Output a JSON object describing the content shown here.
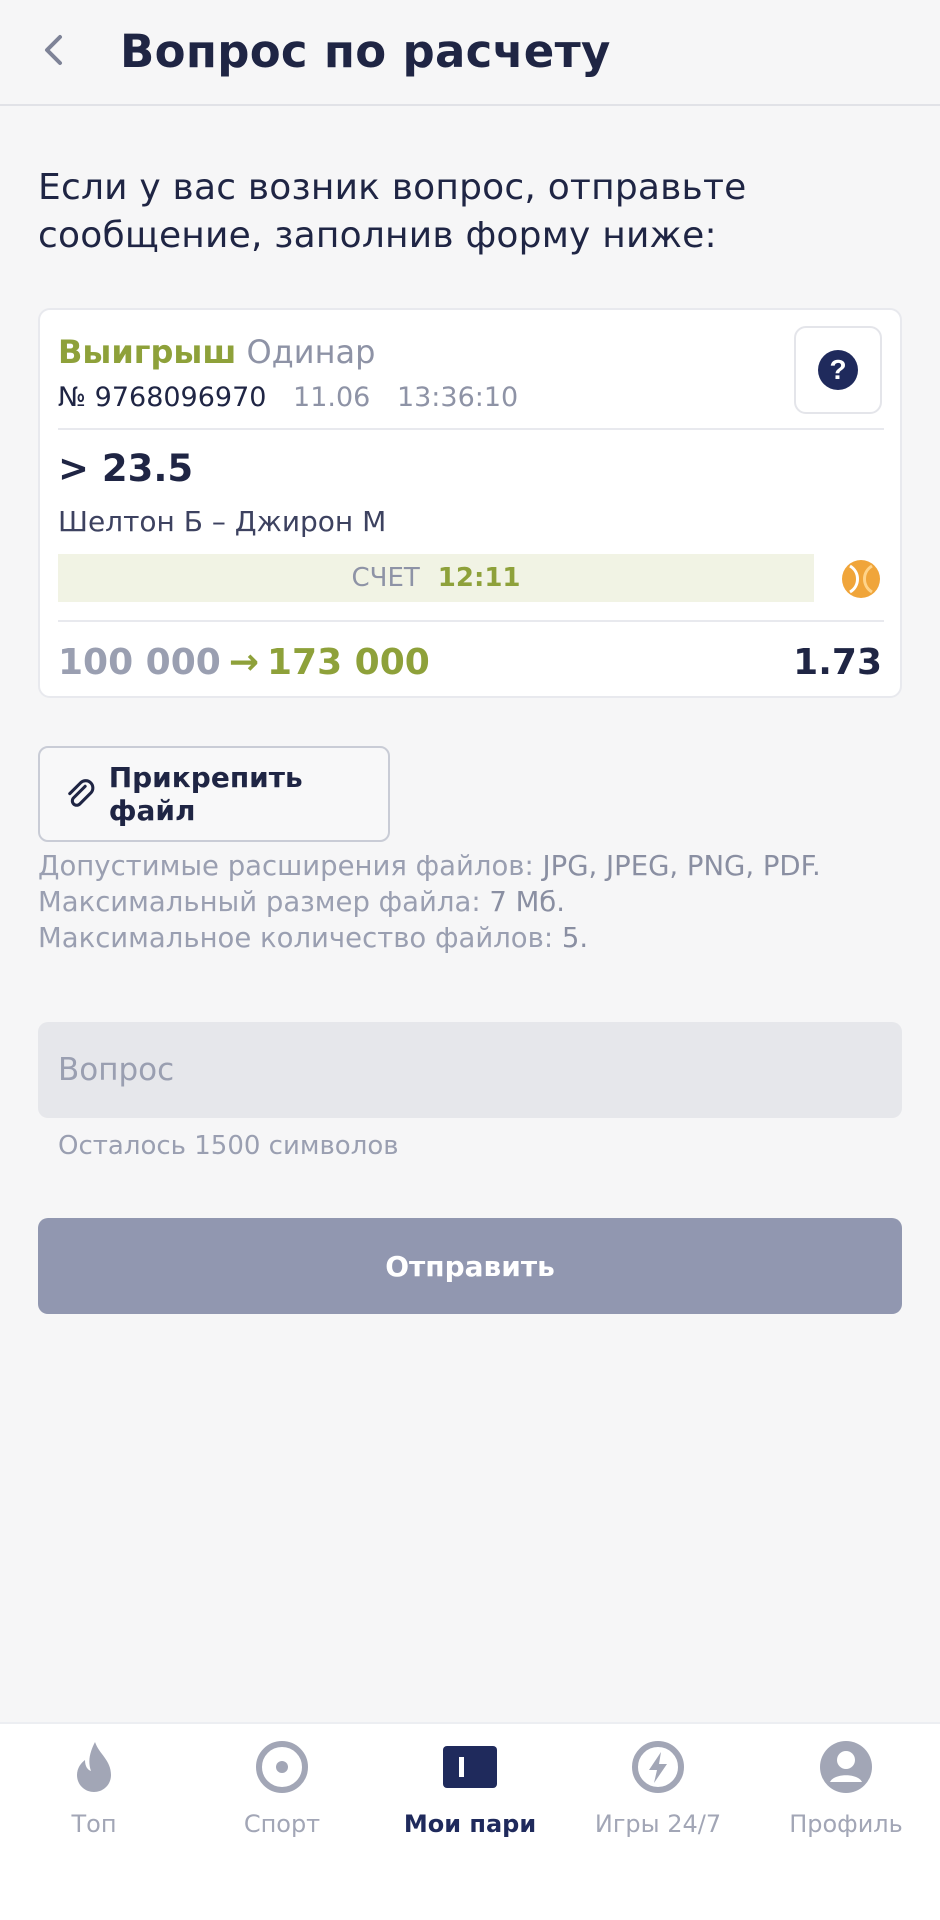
{
  "header": {
    "title": "Вопрос по расчету"
  },
  "intro_text": "Если у вас возник вопрос, отправьте сообщение, заполнив форму ниже:",
  "bet": {
    "status": "Выигрыш",
    "type": "Одинар",
    "number": "№ 9768096970",
    "date": "11.06",
    "time": "13:36:10",
    "outcome": "> 23.5",
    "event": "Шелтон Б – Джирон М",
    "score_label": "СЧЕТ",
    "score_value": "12:11",
    "stake": "100 000",
    "arrow": "→",
    "payout": "173 000",
    "coefficient": "1.73",
    "help_symbol": "?"
  },
  "attach": {
    "label": "Прикрепить файл"
  },
  "file_rules": {
    "ext_label": "Допустимые расширения файлов:",
    "ext_value": "JPG, JPEG, PNG, PDF.",
    "size_label": "Максимальный размер файла:",
    "size_value": "7 Мб.",
    "count_label": "Максимальное количество файлов:",
    "count_value": "5."
  },
  "question": {
    "placeholder": "Вопрос",
    "value": "",
    "chars_left": "Осталось 1500 символов"
  },
  "submit_label": "Отправить",
  "tabs": [
    {
      "label": "Топ",
      "icon": "flame-icon"
    },
    {
      "label": "Спорт",
      "icon": "sport-target-icon"
    },
    {
      "label": "Мои пари",
      "icon": "ticket-icon",
      "active": true
    },
    {
      "label": "Игры 24/7",
      "icon": "lightning-icon"
    },
    {
      "label": "Профиль",
      "icon": "profile-icon"
    }
  ],
  "colors": {
    "primary": "#1f2544",
    "win_green": "#8ea13a",
    "muted": "#9a9fb1",
    "submit_disabled": "#9197b0",
    "tennis_orange": "#f0a53a"
  }
}
